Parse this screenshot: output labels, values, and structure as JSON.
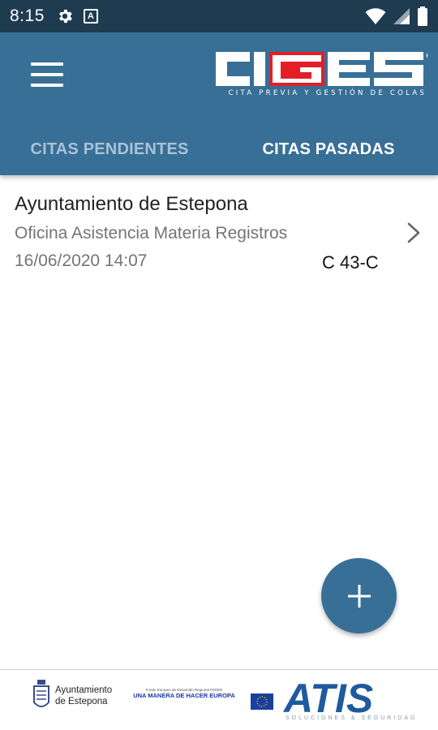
{
  "status_bar": {
    "time": "8:15",
    "icons": [
      "gear-icon",
      "a-icon",
      "wifi-icon",
      "signal-icon",
      "battery-icon"
    ]
  },
  "app_bar": {
    "logo_text": "CIGES",
    "logo_subtitle": "CITA PREVIA Y GESTIÓN DE COLAS",
    "menu_icon": "hamburger-menu-icon",
    "tabs": [
      {
        "label": "CITAS PENDIENTES",
        "active": false
      },
      {
        "label": "CITAS PASADAS",
        "active": true
      }
    ]
  },
  "appointments": [
    {
      "title": "Ayuntamiento de Estepona",
      "office": "Oficina Asistencia Materia Registros",
      "datetime": "16/06/2020 14:07",
      "code": "C 43-C"
    }
  ],
  "fab": {
    "icon": "plus-icon"
  },
  "footer": {
    "ayuntamiento_line1": "Ayuntamiento",
    "ayuntamiento_line2": "de Estepona",
    "feder_small": "Fondo Europeo de Desarrollo Regional FEDER",
    "feder_slogan": "UNA MANERA DE HACER EUROPA",
    "atis_text": "ATIS",
    "atis_subtitle": "SOLUCIONES & SEGURIDAD"
  },
  "colors": {
    "status_bar": "#1f3b4f",
    "primary": "#386f96",
    "tab_inactive": "#a8c3d6",
    "logo_red": "#e41e26"
  }
}
